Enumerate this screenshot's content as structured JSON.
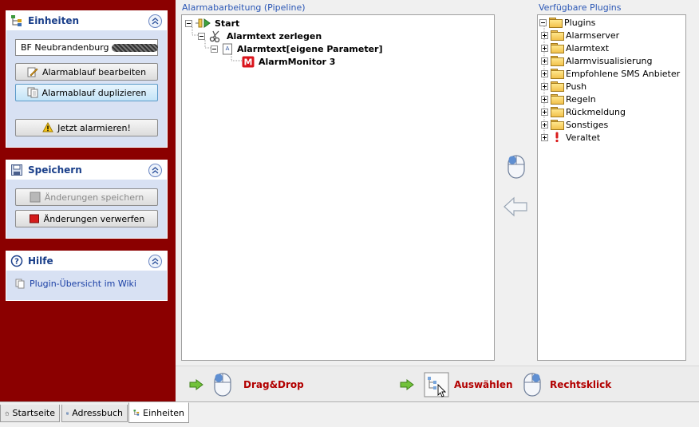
{
  "sidebar": {
    "units_panel": {
      "title": "Einheiten",
      "selected_unit": "BF Neubrandenburg ---",
      "edit_button": "Alarmablauf bearbeiten",
      "duplicate_button": "Alarmablauf duplizieren",
      "alarm_button": "Jetzt alarmieren!"
    },
    "save_panel": {
      "title": "Speichern",
      "save_button": "Änderungen speichern",
      "discard_button": "Änderungen verwerfen"
    },
    "help_panel": {
      "title": "Hilfe",
      "wiki_link": "Plugin-Übersicht im Wiki"
    }
  },
  "pipeline": {
    "title": "Alarmabarbeitung (Pipeline)",
    "nodes": {
      "start": "Start",
      "split": "Alarmtext zerlegen",
      "alarmtext": "Alarmtext[eigene Parameter]",
      "monitor": "AlarmMonitor 3"
    }
  },
  "plugins": {
    "title": "Verfügbare Plugins",
    "root": "Plugins",
    "items": [
      "Alarmserver",
      "Alarmtext",
      "Alarmvisualisierung",
      "Empfohlene SMS Anbieter",
      "Push",
      "Regeln",
      "Rückmeldung",
      "Sonstiges"
    ],
    "deprecated": "Veraltet"
  },
  "hints": {
    "drag_drop": "Drag&Drop",
    "select": "Auswählen",
    "right_click": "Rechtsklick"
  },
  "tabs": [
    "Startseite",
    "Adressbuch",
    "Einheiten"
  ],
  "colors": {
    "sidebar_bg": "#8b0000",
    "panel_bg": "#d8e1f3",
    "panel_title": "#1a3f8a",
    "hint_text": "#b20000"
  }
}
